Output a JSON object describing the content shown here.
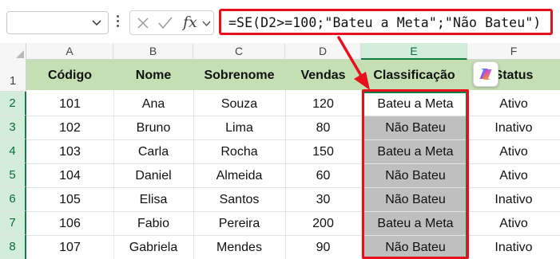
{
  "formula_bar": {
    "name_box_value": "",
    "fx_label": "fx",
    "formula": "=SE(D2>=100;\"Bateu a Meta\";\"Não Bateu\")"
  },
  "grid": {
    "column_headers": [
      "A",
      "B",
      "C",
      "D",
      "E",
      "F"
    ],
    "row_headers": [
      "1",
      "2",
      "3",
      "4",
      "5",
      "6",
      "7",
      "8"
    ],
    "table_headers": [
      "Código",
      "Nome",
      "Sobrenome",
      "Vendas",
      "Classificação",
      "Status"
    ],
    "rows": [
      [
        "101",
        "Ana",
        "Souza",
        "120",
        "Bateu a Meta",
        "Ativo"
      ],
      [
        "102",
        "Bruno",
        "Lima",
        "80",
        "Não Bateu",
        "Inativo"
      ],
      [
        "103",
        "Carla",
        "Rocha",
        "150",
        "Bateu a Meta",
        "Ativo"
      ],
      [
        "104",
        "Daniel",
        "Almeida",
        "60",
        "Não Bateu",
        "Ativo"
      ],
      [
        "105",
        "Elisa",
        "Santos",
        "30",
        "Não Bateu",
        "Inativo"
      ],
      [
        "106",
        "Fabio",
        "Pereira",
        "200",
        "Bateu a Meta",
        "Ativo"
      ],
      [
        "107",
        "Gabriela",
        "Mendes",
        "90",
        "Não Bateu",
        "Inativo"
      ]
    ],
    "selected_column": "E",
    "header_fill_color": "#c4dfb3",
    "result_fill_color": "#bfbfbf",
    "highlight_color": "#e8101b",
    "selection_color": "#107c41"
  },
  "icons": {
    "name_box_dropdown": "chevron-down-icon",
    "cancel": "x-icon",
    "enter": "check-icon",
    "copilot": "copilot-icon",
    "annotation": "red-arrow"
  }
}
